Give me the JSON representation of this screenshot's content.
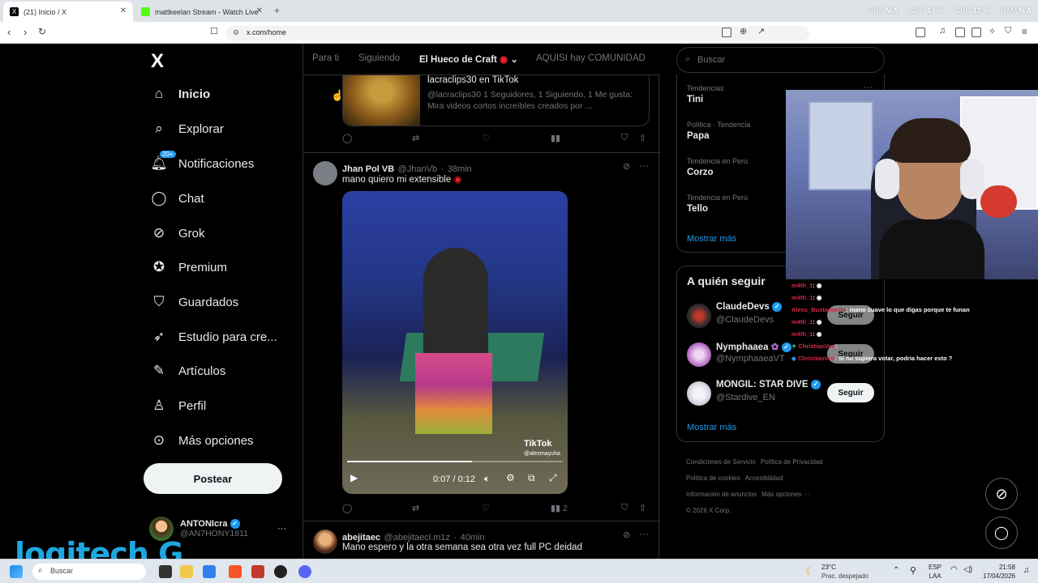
{
  "browser": {
    "tabs": [
      {
        "title": "(21) Inicio / X"
      },
      {
        "title": "mattkeelan Stream - Watch Live on K"
      }
    ],
    "new_tab": "+",
    "url": "x.com/home",
    "perf": {
      "fps_label": "FPS",
      "fps": "N/A",
      "gpu_label": "GPU",
      "gpu": "17 %",
      "cpu_label": "CPU",
      "cpu": "12 %",
      "ram_label": "RAM",
      "ram": "N/A"
    }
  },
  "sidebar": {
    "logo": "X",
    "items": [
      {
        "label": "Inicio",
        "icon": "home-icon"
      },
      {
        "label": "Explorar",
        "icon": "search-icon"
      },
      {
        "label": "Notificaciones",
        "icon": "bell-icon",
        "badge": "20+"
      },
      {
        "label": "Chat",
        "icon": "chat-icon"
      },
      {
        "label": "Grok",
        "icon": "grok-icon"
      },
      {
        "label": "Premium",
        "icon": "premium-icon"
      },
      {
        "label": "Guardados",
        "icon": "bookmark-icon"
      },
      {
        "label": "Estudio para cre...",
        "icon": "rocket-icon"
      },
      {
        "label": "Artículos",
        "icon": "article-icon"
      },
      {
        "label": "Perfil",
        "icon": "person-icon"
      },
      {
        "label": "Más opciones",
        "icon": "more-icon"
      }
    ],
    "post_button": "Postear",
    "account": {
      "name": "ANTONIcra",
      "handle": "@AN7HONY1811"
    }
  },
  "timeline": {
    "tabs": [
      "Para ti",
      "Siguiendo",
      "El Hueco de Craft",
      "AQUISI hay COMUNIDAD"
    ],
    "card": {
      "title": "lacraclips30 en TikTok",
      "description": "@lacraclips30 1 Seguidores, 1 Siguiendo, 1 Me gusta: Mira videos cortos increíbles creados por ..."
    },
    "tweet1": {
      "name": "Jhan Pol VB",
      "handle": "@JhanVb",
      "time": "38min",
      "text": "mano quiero mi extensible",
      "video_time": "0:07 / 0:12",
      "video_watermark": "TikTok",
      "video_user": "@alexmayuha",
      "views": "2",
      "progress": 0.58
    },
    "tweet2": {
      "name": "abejitaec",
      "handle": "@abejitaecl.m1z",
      "time": "40min",
      "text": "Mano espero y la otra semana sea otra vez full PC deidad"
    }
  },
  "right": {
    "search_placeholder": "Buscar",
    "trends": [
      {
        "meta": "Tendencias",
        "name": "Tini"
      },
      {
        "meta": "Política · Tendencia",
        "name": "Papa"
      },
      {
        "meta": "Tendencia en Perú",
        "name": "Corzo"
      },
      {
        "meta": "Tendencia en Perú",
        "name": "Tello"
      }
    ],
    "show_more": "Mostrar más",
    "who_to_follow": "A quién seguir",
    "follow": [
      {
        "name": "ClaudeDevs",
        "handle": "@ClaudeDevs",
        "button": "Seguir"
      },
      {
        "name": "Nymphaaea",
        "handle": "@NymphaaeaVT",
        "button": "Seguir"
      },
      {
        "name": "MONGIL: STAR DIVE",
        "handle": "@Stardive_EN",
        "button": "Seguir"
      }
    ],
    "show_more2": "Mostrar más",
    "footer": [
      "Condiciones de Servicio",
      "Política de Privacidad",
      "Política de cookies",
      "Accesibilidad",
      "Información de anuncios",
      "Más opciones ···",
      "© 2026 X Corp."
    ]
  },
  "stream_chat": [
    {
      "user": "m4th_1",
      "msg": ":",
      "color": "#d6284a"
    },
    {
      "user": "m4th_1",
      "msg": ":",
      "color": "#d6284a"
    },
    {
      "user": "Aless_Bustamante",
      "msg": ": mano suave lo que digas porque te funan",
      "color": "#d6284a"
    },
    {
      "user": "m4th_1",
      "msg": ":",
      "color": "#d6284a"
    },
    {
      "user": "m4th_1",
      "msg": ":",
      "color": "#d6284a"
    },
    {
      "user": "ChristianVec",
      "msg": ":",
      "color": "#d6284a"
    },
    {
      "user": "ChristianVec",
      "msg": ": Si no supiera votar, podria hacer esto ?",
      "color": "#d6284a"
    }
  ],
  "overlay": {
    "logo": "logitech G"
  },
  "taskbar": {
    "search": "Buscar",
    "weather_temp": "23°C",
    "weather_desc": "Prac. despejado",
    "lang1": "ESP",
    "lang2": "LAA",
    "time": "21:58",
    "date": "17/04/2026"
  },
  "colors": {
    "accent": "#1d9bf0",
    "background": "#000000",
    "border": "#2f3336",
    "muted": "#71767b"
  }
}
